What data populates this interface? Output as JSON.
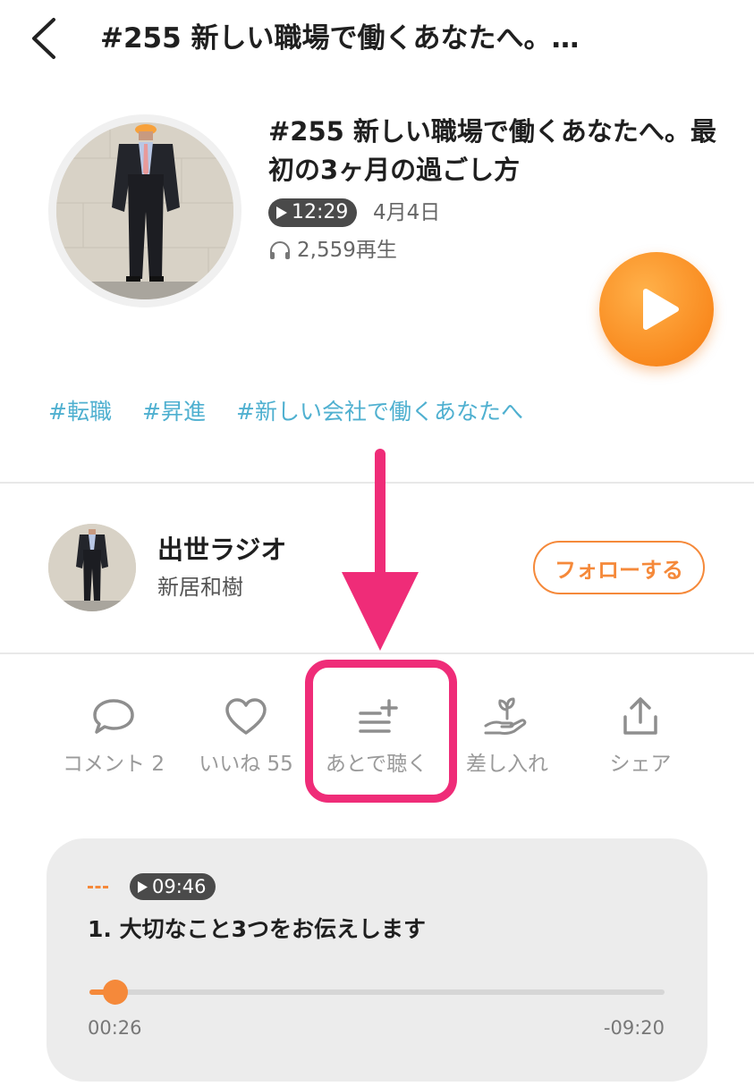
{
  "header": {
    "title": "#255 新しい職場で働くあなたへ。…"
  },
  "episode": {
    "title": "#255 新しい職場で働くあなたへ。最初の3ヶ月の過ごし方",
    "duration": "12:29",
    "date": "4月4日",
    "plays": "2,559再生"
  },
  "tags": [
    "#転職",
    "#昇進",
    "#新しい会社で働くあなたへ"
  ],
  "channel": {
    "name": "出世ラジオ",
    "author": "新居和樹",
    "follow_label": "フォローする"
  },
  "actions": {
    "comment": "コメント 2",
    "like": "いいね 55",
    "listen_later": "あとで聴く",
    "gift": "差し入れ",
    "share": "シェア"
  },
  "chapter": {
    "duration": "09:46",
    "title": "1. 大切なこと3つをお伝えします",
    "elapsed": "00:26",
    "remaining": "-09:20",
    "progress": 0.045
  },
  "colors": {
    "accent": "#f5893a",
    "tag": "#4fb0d0",
    "highlight": "#ef2c78"
  }
}
